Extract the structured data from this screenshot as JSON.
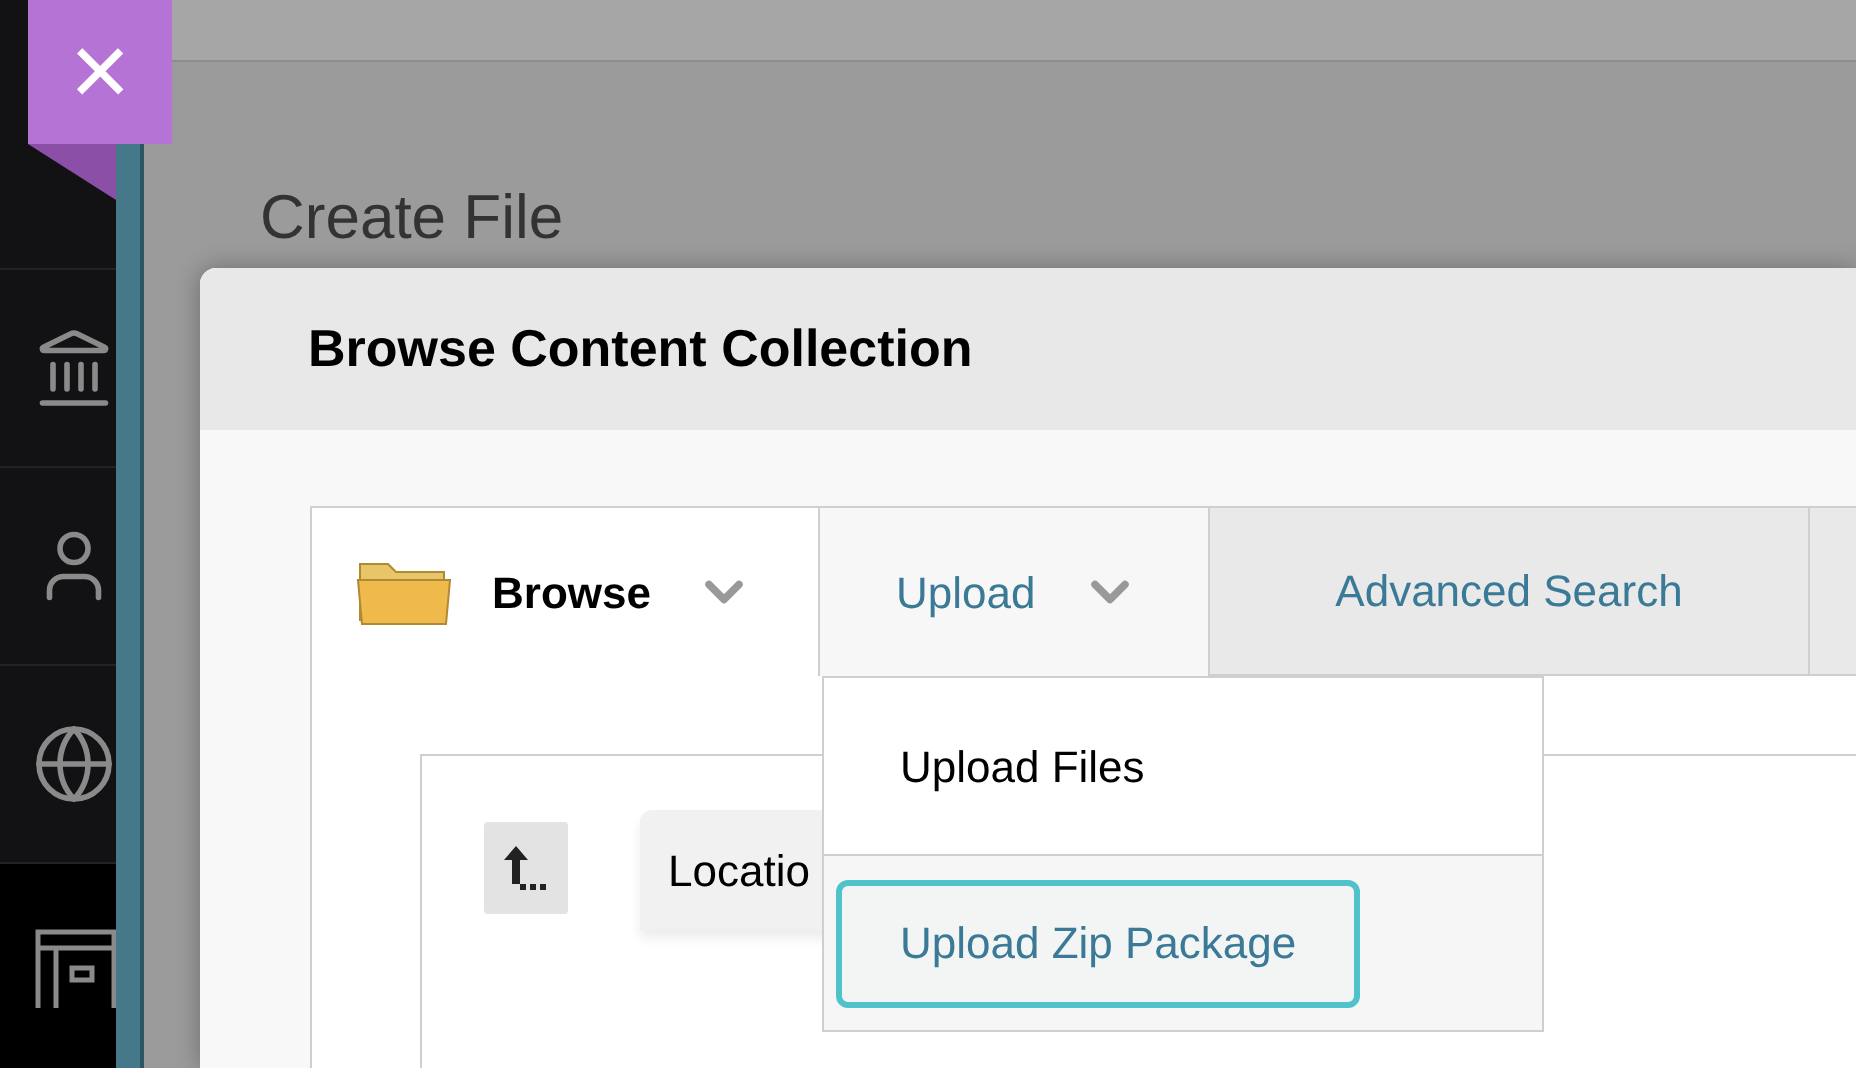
{
  "close_button": {
    "label": "×"
  },
  "sidebar": {
    "items": [
      {
        "kind": "institution",
        "selected": false
      },
      {
        "kind": "profile",
        "selected": false
      },
      {
        "kind": "globe",
        "selected": false
      },
      {
        "kind": "content",
        "selected": true
      }
    ]
  },
  "page": {
    "title": "Create File"
  },
  "dialog": {
    "title": "Browse Content Collection",
    "tabs": [
      {
        "label": "Browse",
        "kind": "folder",
        "expanded": false
      },
      {
        "label": "Upload",
        "kind": "dropdown",
        "expanded": true
      },
      {
        "label": "Advanced Search",
        "kind": "link",
        "expanded": false
      }
    ],
    "menu": [
      {
        "label": "Upload Files",
        "focused": false
      },
      {
        "label": "Upload Zip Package",
        "focused": true
      }
    ],
    "location": {
      "label": "Locatio"
    }
  }
}
